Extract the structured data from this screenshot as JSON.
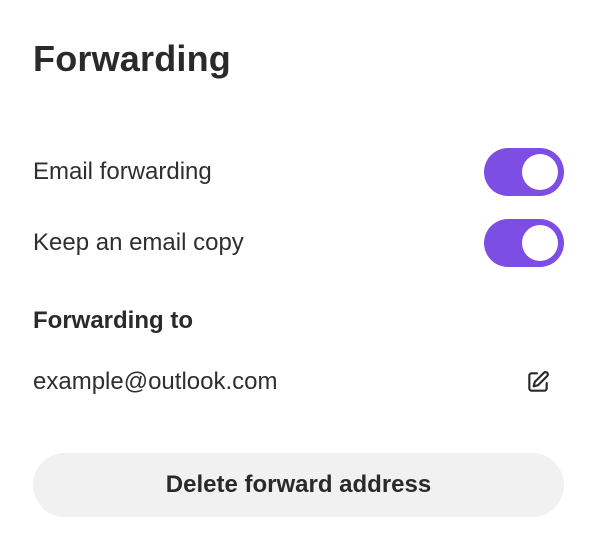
{
  "header": {
    "title": "Forwarding"
  },
  "settings": {
    "email_forwarding": {
      "label": "Email forwarding",
      "enabled": true
    },
    "keep_copy": {
      "label": "Keep an email copy",
      "enabled": true
    }
  },
  "forwarding_to": {
    "heading": "Forwarding to",
    "address": "example@outlook.com",
    "edit_icon": "edit-icon"
  },
  "actions": {
    "delete_label": "Delete forward address"
  },
  "colors": {
    "toggle_on": "#7c4ee4",
    "toggle_knob": "#ffffff",
    "button_bg": "#f1f1f1",
    "text": "#2a2a2a"
  }
}
